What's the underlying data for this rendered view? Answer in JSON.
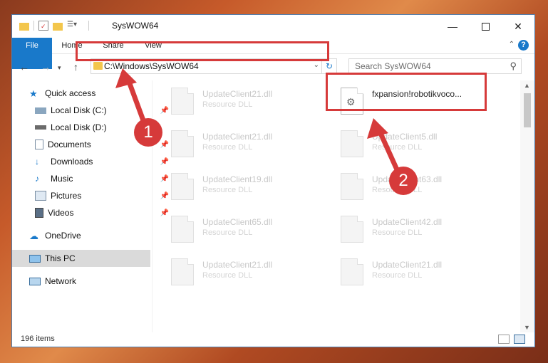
{
  "window": {
    "title": "SysWOW64",
    "minimize_icon": "minimize-icon",
    "maximize_icon": "maximize-icon",
    "close_icon": "close-icon"
  },
  "ribbon": {
    "tabs": [
      {
        "label": "File"
      },
      {
        "label": "Home"
      },
      {
        "label": "Share"
      },
      {
        "label": "View"
      }
    ],
    "help": "?"
  },
  "navigation": {
    "address": "C:\\Windows\\SysWOW64",
    "search_placeholder": "Search SysWOW64"
  },
  "sidebar": {
    "items": [
      {
        "label": "Quick access",
        "icon": "star-icon"
      },
      {
        "label": "Local Disk (C:)",
        "icon": "drive-icon"
      },
      {
        "label": "Local Disk (D:)",
        "icon": "drive-icon"
      },
      {
        "label": "Documents",
        "icon": "documents-icon"
      },
      {
        "label": "Downloads",
        "icon": "download-icon"
      },
      {
        "label": "Music",
        "icon": "music-icon"
      },
      {
        "label": "Pictures",
        "icon": "pictures-icon"
      },
      {
        "label": "Videos",
        "icon": "videos-icon"
      },
      {
        "label": "OneDrive",
        "icon": "cloud-icon"
      },
      {
        "label": "This PC",
        "icon": "computer-icon"
      },
      {
        "label": "Network",
        "icon": "network-icon"
      }
    ]
  },
  "files": [
    {
      "name": "UpdateClient21.dll",
      "type": "Resource DLL"
    },
    {
      "name": "fxpansion!robotikvoco...",
      "type": ""
    },
    {
      "name": "UpdateClient21.dll",
      "type": "Resource DLL"
    },
    {
      "name": "UpdateClient5.dll",
      "type": "Resource DLL"
    },
    {
      "name": "UpdateClient19.dll",
      "type": "Resource DLL"
    },
    {
      "name": "UpdateClient63.dll",
      "type": "Resource DLL"
    },
    {
      "name": "UpdateClient65.dll",
      "type": "Resource DLL"
    },
    {
      "name": "UpdateClient42.dll",
      "type": "Resource DLL"
    },
    {
      "name": "UpdateClient21.dll",
      "type": "Resource DLL"
    },
    {
      "name": "UpdateClient21.dll",
      "type": "Resource DLL"
    }
  ],
  "status": {
    "item_count": "196 items"
  },
  "annotations": {
    "step1": "1",
    "step2": "2",
    "color": "#d63a3a"
  }
}
